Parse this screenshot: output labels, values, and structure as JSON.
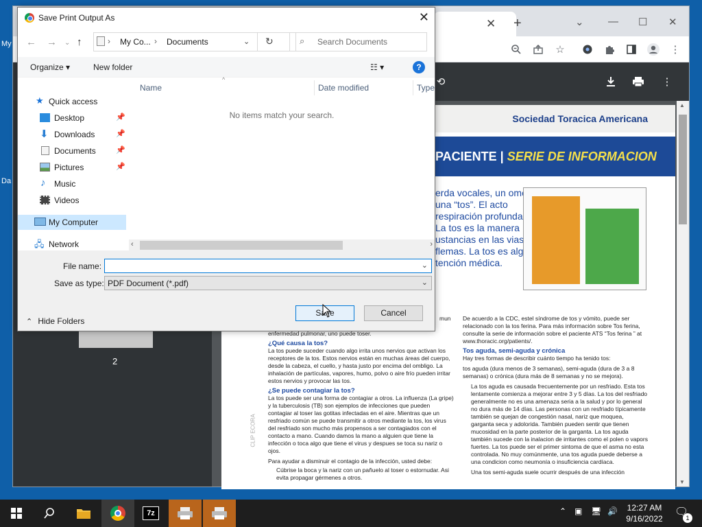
{
  "desktop": {
    "labels": [
      "My",
      "Da"
    ]
  },
  "chrome": {
    "toolbar_icons": [
      "zoom-icon",
      "share-icon",
      "star-icon",
      "extension-icon",
      "puzzle-icon",
      "sidepanel-icon",
      "profile-icon",
      "menu-icon"
    ]
  },
  "pdf": {
    "org": "Sociedad Toracica Americana",
    "banner_left": "PACIENTE | ",
    "banner_right": "SERIE DE INFORMACION",
    "intro": "erda vocales, un omo una “tos”. El acto respiración profunda, a. La tos es la manera ustancias en las vias flemas. La tos es algo tención médica.",
    "col1_top": "mun",
    "col1_prev": "enfermedad pulmonar, uno puede toser.",
    "q1": "¿Qué causa la tos?",
    "p1": "La tos puede suceder cuando algo irrita unos nervios que activan los receptores de la tos. Estos nervios están en muchas áreas del cuerpo, desde la cabeza, el cuello, y hasta justo por encima del ombligo. La inhalación de partículas, vapores, humo, polvo o aire frío pueden irritar estos nervios y provocar las tos.",
    "q2": "¿Se puede contagiar la tos?",
    "p2": "La tos puede ser una forma de contagiar a otros. La influenza (La gripe) y la tuberculosis (TB) son ejemplos de infecciones que pueden contagiar al toser las gotitas infectadas en el aire. Mientras que un resfriado común se puede transmitir a otros mediante la tos, los virus del resfriado son mucho más propensos a ser contagiados con el contacto a mano. Cuando damos la mano a alguien que tiene la infección o toca algo que tiene el virus y despues se toca su nariz o ojos.",
    "p3": "Para ayudar a disminuir el contagio de la infección, usted debe:",
    "b1": "Cúbrise la boca y la nariz con un pañuelo al toser o estornudar. Asi evita propagar gérmenes a otros.",
    "col2_p1": "De acuerdo a la CDC, estel síndrome de tos y vómito, puede ser relacionado con la tos ferina. Para más información sobre Tos ferina, consulte la serie de información sobre el paciente ATS “Tos ferina ” at www.thoracic.org/patients/.",
    "q3": "Tos aguda, semi-aguda y crónica",
    "col2_p2": "Hay tres formas de describir cuánto tiempo ha tenido tos:",
    "col2_p3": "tos aguda (dura menos de 3 semanas), semi-aguda (dura de 3 a 8 semanas) o crónica (dura más de 8 semanas y no se mejora).",
    "col2_b1": "La tos aguda es causada frecuentemente por un resfriado. Esta tos lentamente comienza a mejorar entre 3 y 5 días. La tos del resfriado generalmente no es una amenaza seria a la salud y por lo general no dura más de 14 días. Las personas con un resfriado típicamente también se quejan de congestión nasal, nariz que moquea, garganta seca y adolorida. También pueden sentir que tienen mucosidad en la parte posterior de la garganta. La tos aguda también sucede con la inalacion de irritantes como el polen o vapors fuertes. La tos puede ser el primer sintoma de que el asma no esta controlada. No muy comúnmente, una tos aguda puede deberse a una condicion como neumonía o insuficiencia cardíaca.",
    "col2_b2": "Una tos semi-aguda suele ocurrir después de una infección",
    "side_text": "CLIP ECORA",
    "thumb_number": "2"
  },
  "dialog": {
    "title": "Save Print Output As",
    "close": "✕",
    "nav": {
      "breadcrumb": [
        "My Co...",
        "Documents"
      ],
      "search_placeholder": "Search Documents"
    },
    "commands": {
      "organize": "Organize ▾",
      "new_folder": "New folder"
    },
    "nav_pane": {
      "quick_access": "Quick access",
      "items": [
        "Desktop",
        "Downloads",
        "Documents",
        "Pictures",
        "Music",
        "Videos"
      ],
      "computer": "My Computer",
      "network": "Network"
    },
    "columns": [
      "Name",
      "Date modified",
      "Type"
    ],
    "empty_message": "No items match your search.",
    "file_name_label": "File name:",
    "file_name_value": "",
    "save_type_label": "Save as type:",
    "save_type_value": "PDF Document (*.pdf)",
    "hide_folders": "Hide Folders",
    "save_button": "Save",
    "cancel_button": "Cancel"
  },
  "taskbar": {
    "time": "12:27 AM",
    "date": "9/16/2022",
    "notification_count": "1"
  }
}
